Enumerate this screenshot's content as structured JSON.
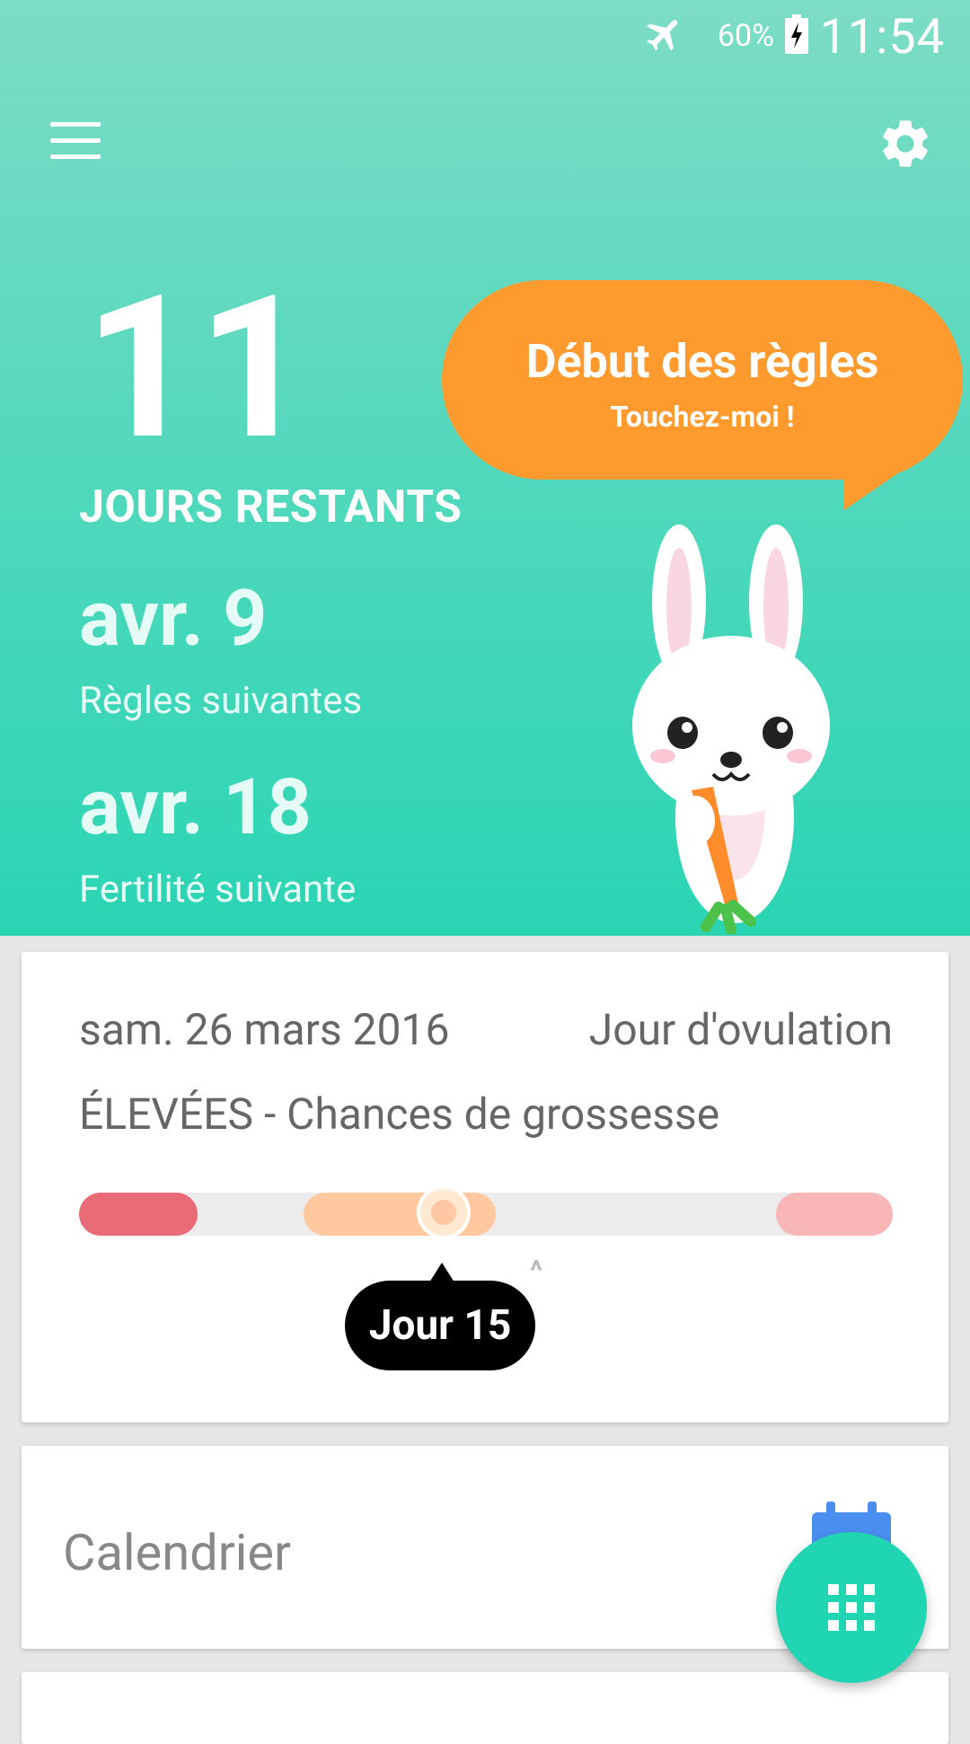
{
  "status_bar": {
    "time": "11:54",
    "battery": "60%",
    "icons": [
      "airplane-icon",
      "battery-charging-icon"
    ]
  },
  "toolbar": {
    "icons": [
      "menu-icon",
      "settings-gear-icon"
    ]
  },
  "summary": {
    "days_remaining": "11",
    "days_remaining_label": "JOURS RESTANTS",
    "next_period_date": "avr. 9",
    "next_period_label": "Règles suivantes",
    "next_fertility_date": "avr. 18",
    "next_fertility_label": "Fertilité suivante"
  },
  "bubble": {
    "title": "Début des règles",
    "subtitle": "Touchez-moi !"
  },
  "today_card": {
    "date": "sam. 26 mars 2016",
    "phase": "Jour d'ovulation",
    "chance": "ÉLEVÉES - Chances de grossesse",
    "day_label": "Jour 15"
  },
  "calendar_card": {
    "title": "Calendrier",
    "icon": "calendar-icon"
  },
  "fab": {
    "icon": "grid-icon"
  },
  "colors": {
    "header_top": "#7ddcc6",
    "header_bottom": "#2ad5b4",
    "bubble": "#ff9a2f",
    "period": "#e96b77",
    "fertile": "#ffc89e",
    "predicted_period": "#f8b6b6",
    "fab": "#1fd5b2",
    "calendar_blue": "#4a8ef0"
  }
}
